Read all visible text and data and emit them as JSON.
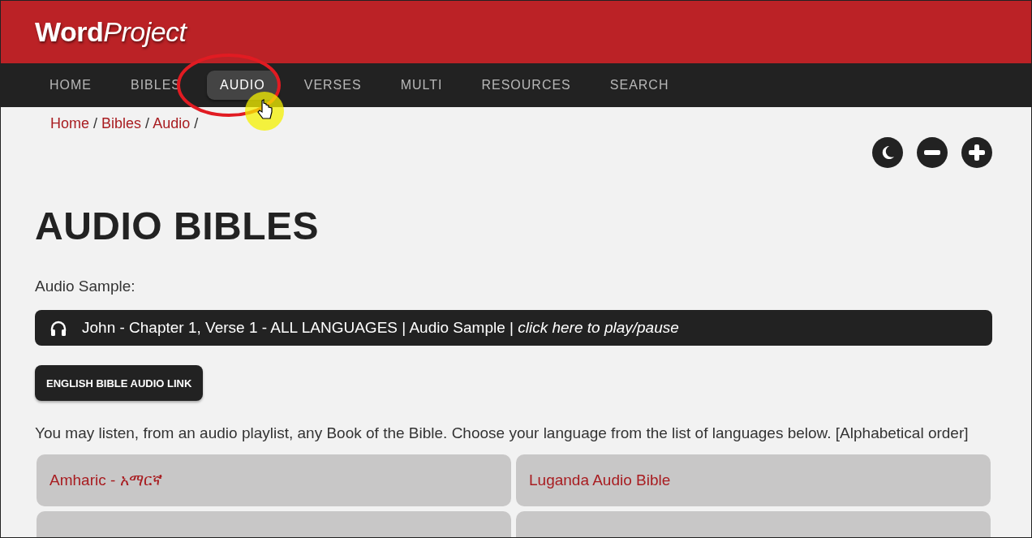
{
  "logo": {
    "bold": "Word",
    "italic": "Project"
  },
  "nav": [
    {
      "label": "HOME",
      "selected": false
    },
    {
      "label": "BIBLES",
      "selected": false
    },
    {
      "label": "AUDIO",
      "selected": true
    },
    {
      "label": "VERSES",
      "selected": false
    },
    {
      "label": "MULTI",
      "selected": false
    },
    {
      "label": "RESOURCES",
      "selected": false
    },
    {
      "label": "SEARCH",
      "selected": false
    }
  ],
  "annotation": {
    "circled_tab": true,
    "cursor_highlight": true
  },
  "breadcrumb": [
    "Home",
    "Bibles",
    "Audio"
  ],
  "breadcrumb_separator": "/",
  "tools": [
    {
      "kind": "moon"
    },
    {
      "kind": "minus"
    },
    {
      "kind": "plus"
    }
  ],
  "heading": "AUDIO BIBLES",
  "sample_label": "Audio Sample:",
  "audio_bar": "John - Chapter 1, Verse 1 - ALL LANGUAGES | Audio Sample | *click here to play/pause*",
  "english_button": "ENGLISH BIBLE AUDIO LINK",
  "intro": "You may listen, from an audio playlist, any Book of the Bible. Choose your language from the list of languages below. [Alphabetical order]",
  "languages": [
    {
      "label": "Amharic - አማርኛ"
    },
    {
      "label": "Luganda Audio Bible"
    }
  ],
  "cut_off_row": true
}
